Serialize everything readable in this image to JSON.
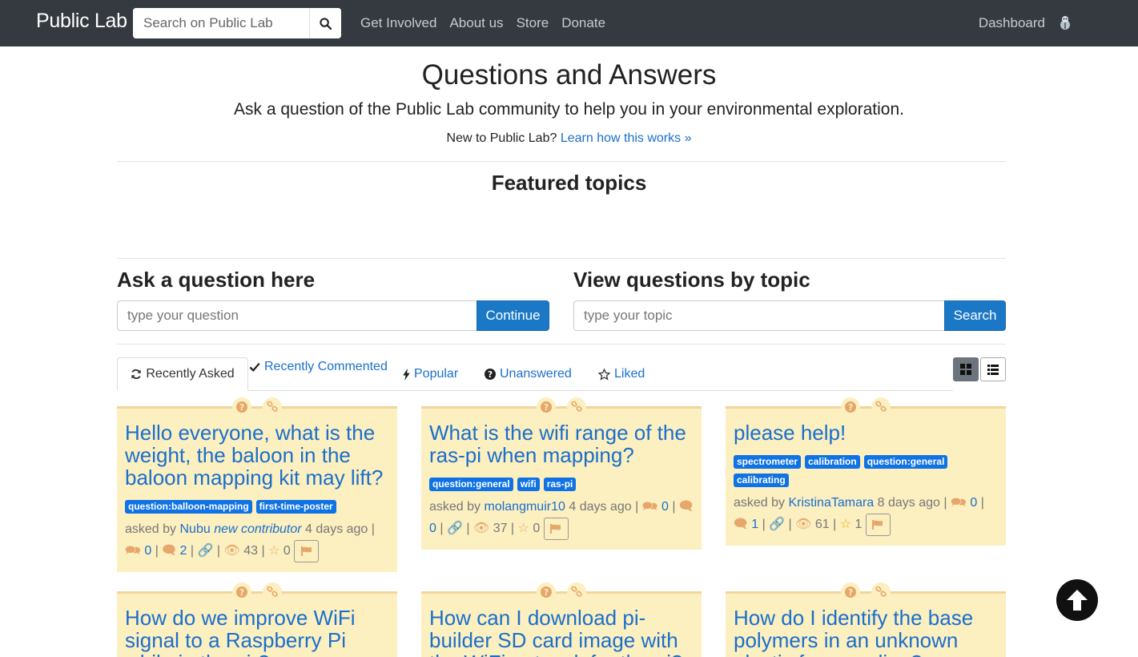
{
  "navbar": {
    "brand": "Public Lab",
    "search_placeholder": "Search on Public Lab",
    "links": [
      "Get Involved",
      "About us",
      "Store",
      "Donate"
    ],
    "dashboard": "Dashboard"
  },
  "header": {
    "title": "Questions and Answers",
    "subtitle": "Ask a question of the Public Lab community to help you in your environmental exploration.",
    "new_prefix": "New to Public Lab?",
    "new_link": "Learn how this works »",
    "featured": "Featured topics"
  },
  "ask": {
    "title": "Ask a question here",
    "placeholder": "type your question",
    "button": "Continue"
  },
  "view": {
    "title": "View questions by topic",
    "placeholder": "type your topic",
    "button": "Search"
  },
  "tabs": [
    "Recently Asked",
    "Recently Commented",
    "Popular",
    "Unanswered",
    "Liked"
  ],
  "cards": [
    {
      "title": "Hello everyone, what is the weight, the baloon in the baloon mapping kit may lift?",
      "tags": [
        "question:balloon-mapping",
        "first-time-poster"
      ],
      "asked_by": "asked by",
      "author": "Nubu",
      "badge": "new contributor",
      "time": "4 days ago",
      "answers": "0",
      "comments": "2",
      "views": "43",
      "likes": "0"
    },
    {
      "title": "What is the wifi range of the ras-pi when mapping?",
      "tags": [
        "question:general",
        "wifi",
        "ras-pi"
      ],
      "asked_by": "asked by",
      "author": "molangmuir10",
      "time": "4 days ago",
      "answers": "0",
      "comments": "0",
      "views": "37",
      "likes": "0"
    },
    {
      "title": "please help!",
      "tags": [
        "spectrometer",
        "calibration",
        "question:general",
        "calibrating"
      ],
      "asked_by": "asked by",
      "author": "KristinaTamara",
      "time": "8 days ago",
      "answers": "0",
      "comments": "1",
      "views": "61",
      "likes": "1"
    },
    {
      "title": "How do we improve WiFi signal to a Raspberry Pi while in the air?"
    },
    {
      "title": "How can I download pi-builder SD card image with the WiFi network for the pi?"
    },
    {
      "title": "How do I identify the base polymers in an unknown plastic for recycling?"
    }
  ]
}
